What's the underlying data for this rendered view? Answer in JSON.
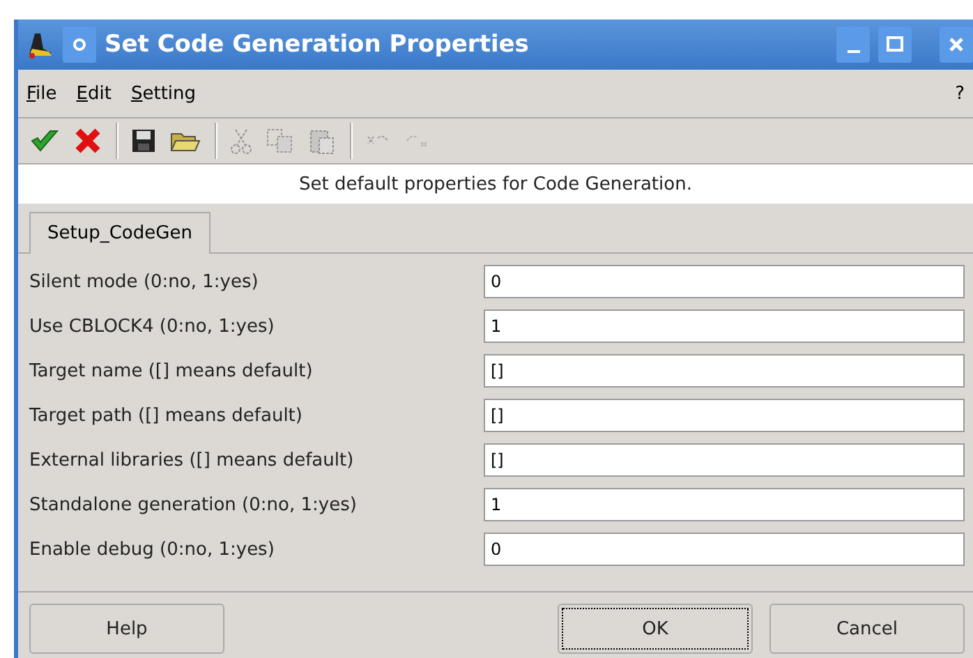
{
  "window": {
    "title": "Set Code Generation Properties"
  },
  "menu": [
    {
      "label": "File"
    },
    {
      "label": "Edit"
    },
    {
      "label": "Setting"
    }
  ],
  "help_menu": {
    "label": "?"
  },
  "toolbar": [
    {
      "kind": "ok",
      "disabled": false
    },
    {
      "kind": "cancel",
      "disabled": false
    },
    {
      "kind": "separator"
    },
    {
      "kind": "save",
      "disabled": false
    },
    {
      "kind": "open",
      "disabled": false
    },
    {
      "kind": "separator"
    },
    {
      "kind": "cut",
      "disabled": true
    },
    {
      "kind": "copy",
      "disabled": true
    },
    {
      "kind": "paste",
      "disabled": true
    },
    {
      "kind": "separator"
    },
    {
      "kind": "undo",
      "disabled": true
    },
    {
      "kind": "redo",
      "disabled": true
    }
  ],
  "description": "Set default properties for Code Generation.",
  "tabs": [
    {
      "label": "Setup_CodeGen",
      "selected": true
    }
  ],
  "fields": [
    {
      "label": "Silent mode (0:no, 1:yes)",
      "value": "0"
    },
    {
      "label": "Use CBLOCK4 (0:no, 1:yes)",
      "value": "1"
    },
    {
      "label": "Target name ([] means default)",
      "value": "[]"
    },
    {
      "label": "Target path ([] means default)",
      "value": "[]"
    },
    {
      "label": "External libraries ([] means default)",
      "value": "[]"
    },
    {
      "label": "Standalone generation (0:no, 1:yes)",
      "value": "1"
    },
    {
      "label": "Enable debug (0:no, 1:yes)",
      "value": "0"
    }
  ],
  "buttons": [
    {
      "label": "Help",
      "focused": false
    },
    {
      "label": "OK",
      "focused": true
    },
    {
      "label": "Cancel",
      "focused": false
    }
  ]
}
